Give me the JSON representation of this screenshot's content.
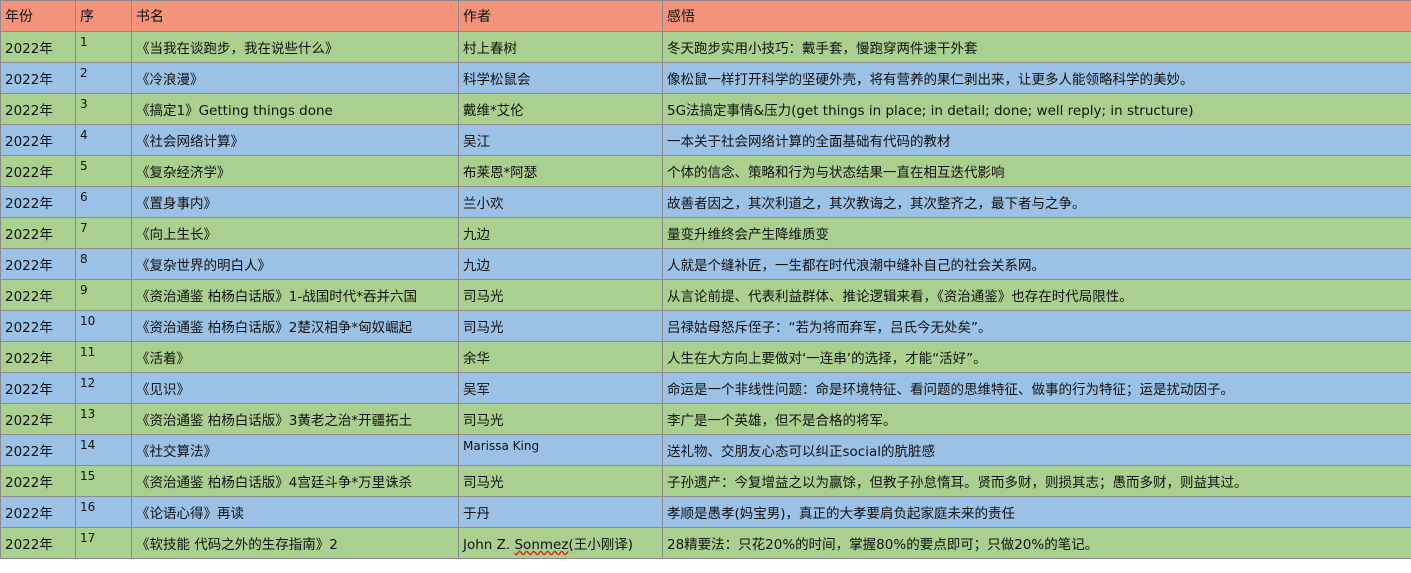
{
  "header": {
    "year": "年份",
    "no": "序",
    "title": "书名",
    "author": "作者",
    "note": "感悟"
  },
  "colors": {
    "header": "#f4937b",
    "row_green": "#a9d08e",
    "row_blue": "#9bc2e6"
  },
  "rows": [
    {
      "year": "2022年",
      "no": "1",
      "title": "《当我在谈跑步，我在说些什么》",
      "author": "村上春树",
      "note": "冬天跑步实用小技巧：戴手套，慢跑穿两件速干外套"
    },
    {
      "year": "2022年",
      "no": "2",
      "title": "《冷浪漫》",
      "author": "科学松鼠会",
      "note": "像松鼠一样打开科学的坚硬外壳，将有营养的果仁剥出来，让更多人能领略科学的美妙。"
    },
    {
      "year": "2022年",
      "no": "3",
      "title": "《搞定1》Getting things done",
      "author": "戴维*艾伦",
      "note": "5G法搞定事情&压力(get things in place; in detail; done; well reply; in structure)"
    },
    {
      "year": "2022年",
      "no": "4",
      "title": "《社会网络计算》",
      "author": "吴江",
      "note": "一本关于社会网络计算的全面基础有代码的教材"
    },
    {
      "year": "2022年",
      "no": "5",
      "title": "《复杂经济学》",
      "author": "布莱恩*阿瑟",
      "note": "个体的信念、策略和行为与状态结果一直在相互迭代影响"
    },
    {
      "year": "2022年",
      "no": "6",
      "title": "《置身事内》",
      "author": "兰小欢",
      "note": "故善者因之，其次利道之，其次教诲之，其次整齐之，最下者与之争。"
    },
    {
      "year": "2022年",
      "no": "7",
      "title": "《向上生长》",
      "author": "九边",
      "note": "量变升维终会产生降维质变"
    },
    {
      "year": "2022年",
      "no": "8",
      "title": "《复杂世界的明白人》",
      "author": "九边",
      "note": "人就是个缝补匠，一生都在时代浪潮中缝补自己的社会关系网。"
    },
    {
      "year": "2022年",
      "no": "9",
      "title": "《资治通鉴 柏杨白话版》1-战国时代*吞并六国",
      "author": "司马光",
      "note": "从言论前提、代表利益群体、推论逻辑来看，《资治通鉴》也存在时代局限性。"
    },
    {
      "year": "2022年",
      "no": "10",
      "title": "《资治通鉴 柏杨白话版》2楚汉相争*匈奴崛起",
      "author": "司马光",
      "note": "吕禄姑母怒斥侄子：“若为将而弃军，吕氏今无处矣”。"
    },
    {
      "year": "2022年",
      "no": "11",
      "title": "《活着》",
      "author": "余华",
      "note": "人生在大方向上要做对‘一连串’的选择，才能“活好”。"
    },
    {
      "year": "2022年",
      "no": "12",
      "title": "《见识》",
      "author": "吴军",
      "note": "命运是一个非线性问题：命是环境特征、看问题的思维特征、做事的行为特征；运是扰动因子。"
    },
    {
      "year": "2022年",
      "no": "13",
      "title": "《资治通鉴 柏杨白话版》3黄老之治*开疆拓土",
      "author": "司马光",
      "note": "李广是一个英雄，但不是合格的将军。"
    },
    {
      "year": "2022年",
      "no": "14",
      "title": "《社交算法》",
      "author": "Marissa King",
      "note": "送礼物、交朋友心态可以纠正social的肮脏感"
    },
    {
      "year": "2022年",
      "no": "15",
      "title": "《资治通鉴 柏杨白话版》4宫廷斗争*万里诛杀",
      "author": "司马光",
      "note": "子孙遗产：今复增益之以为赢馀，但教子孙怠惰耳。贤而多财，则损其志；愚而多财，则益其过。"
    },
    {
      "year": "2022年",
      "no": "16",
      "title": "《论语心得》再读",
      "author": "于丹",
      "note": "孝顺是愚孝(妈宝男)，真正的大孝要肩负起家庭未来的责任"
    },
    {
      "year": "2022年",
      "no": "17",
      "title": "《软技能 代码之外的生存指南》2",
      "author_pre": "John Z. ",
      "author_spell": "Sonmez",
      "author_post": "(王小刚译)",
      "note": "28精要法：只花20%的时间，掌握80%的要点即可；只做20%的笔记。"
    }
  ]
}
